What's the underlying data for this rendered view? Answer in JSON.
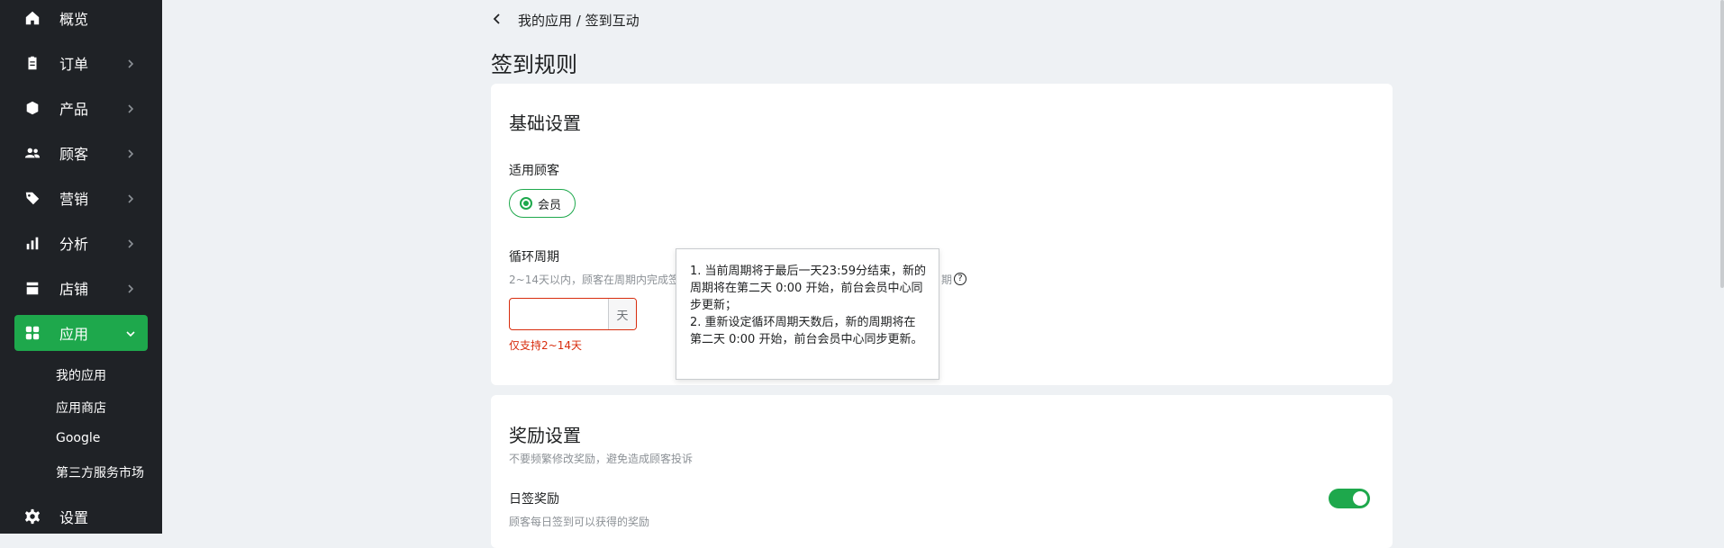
{
  "sidebar": {
    "items": [
      {
        "label": "概览",
        "icon": "home-icon"
      },
      {
        "label": "订单",
        "icon": "order-icon"
      },
      {
        "label": "产品",
        "icon": "product-icon"
      },
      {
        "label": "顾客",
        "icon": "customers-icon"
      },
      {
        "label": "营销",
        "icon": "tag-icon"
      },
      {
        "label": "分析",
        "icon": "analytics-icon"
      },
      {
        "label": "店铺",
        "icon": "store-icon"
      },
      {
        "label": "应用",
        "icon": "apps-icon"
      }
    ],
    "app_subitems": [
      "我的应用",
      "应用商店",
      "Google",
      "第三方服务市场"
    ],
    "settings_label": "设置"
  },
  "breadcrumb": {
    "text": "我的应用 / 签到互动"
  },
  "page_title": "签到规则",
  "basic_settings": {
    "title": "基础设置",
    "customer_label": "适用顾客",
    "customer_option": "会员",
    "cycle_label": "循环周期",
    "cycle_hint": "2~14天以内，顾客在周期内完成签",
    "cycle_hint_tail": "期",
    "days_value": "",
    "days_suffix": "天",
    "error_text": "仅支持2~14天"
  },
  "tooltip": {
    "line1": "1. 当前周期将于最后一天23:59分结束，新的周期将在第二天 0:00 开始，前台会员中心同步更新；",
    "line2": "2. 重新设定循环周期天数后，新的周期将在第二天 0:00 开始，前台会员中心同步更新。"
  },
  "reward_settings": {
    "title": "奖励设置",
    "hint": "不要频繁修改奖励，避免造成顾客投诉",
    "daily_label": "日签奖励",
    "daily_hint": "顾客每日签到可以获得的奖励",
    "daily_enabled": true
  },
  "colors": {
    "accent": "#1ea84c",
    "error": "#d82c0d",
    "sidebar_bg": "#1f2226"
  }
}
